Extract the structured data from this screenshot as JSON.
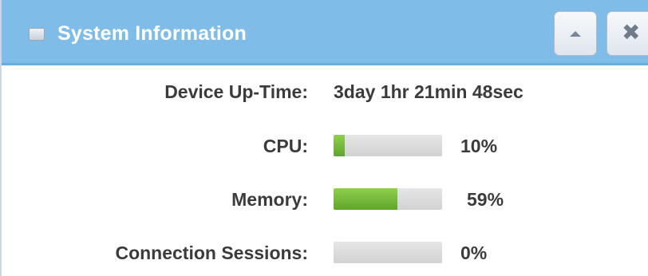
{
  "header": {
    "title": "System Information",
    "colors": {
      "header_bg": "#7fbde8",
      "bar_fill": "#6fb83a",
      "bar_track": "#d9d9d9"
    },
    "icons": {
      "title": "panel-icon",
      "collapse": "chevron-up-icon",
      "close": "close-icon"
    },
    "close_glyph": "✖"
  },
  "rows": {
    "uptime": {
      "label": "Device Up-Time:",
      "value": "3day 1hr 21min 48sec"
    },
    "cpu": {
      "label": "CPU:",
      "value": "10%",
      "percent": 10
    },
    "memory": {
      "label": "Memory:",
      "value": "59%",
      "percent": 59
    },
    "sessions": {
      "label": "Connection Sessions:",
      "value": "0%",
      "percent": 0
    }
  }
}
